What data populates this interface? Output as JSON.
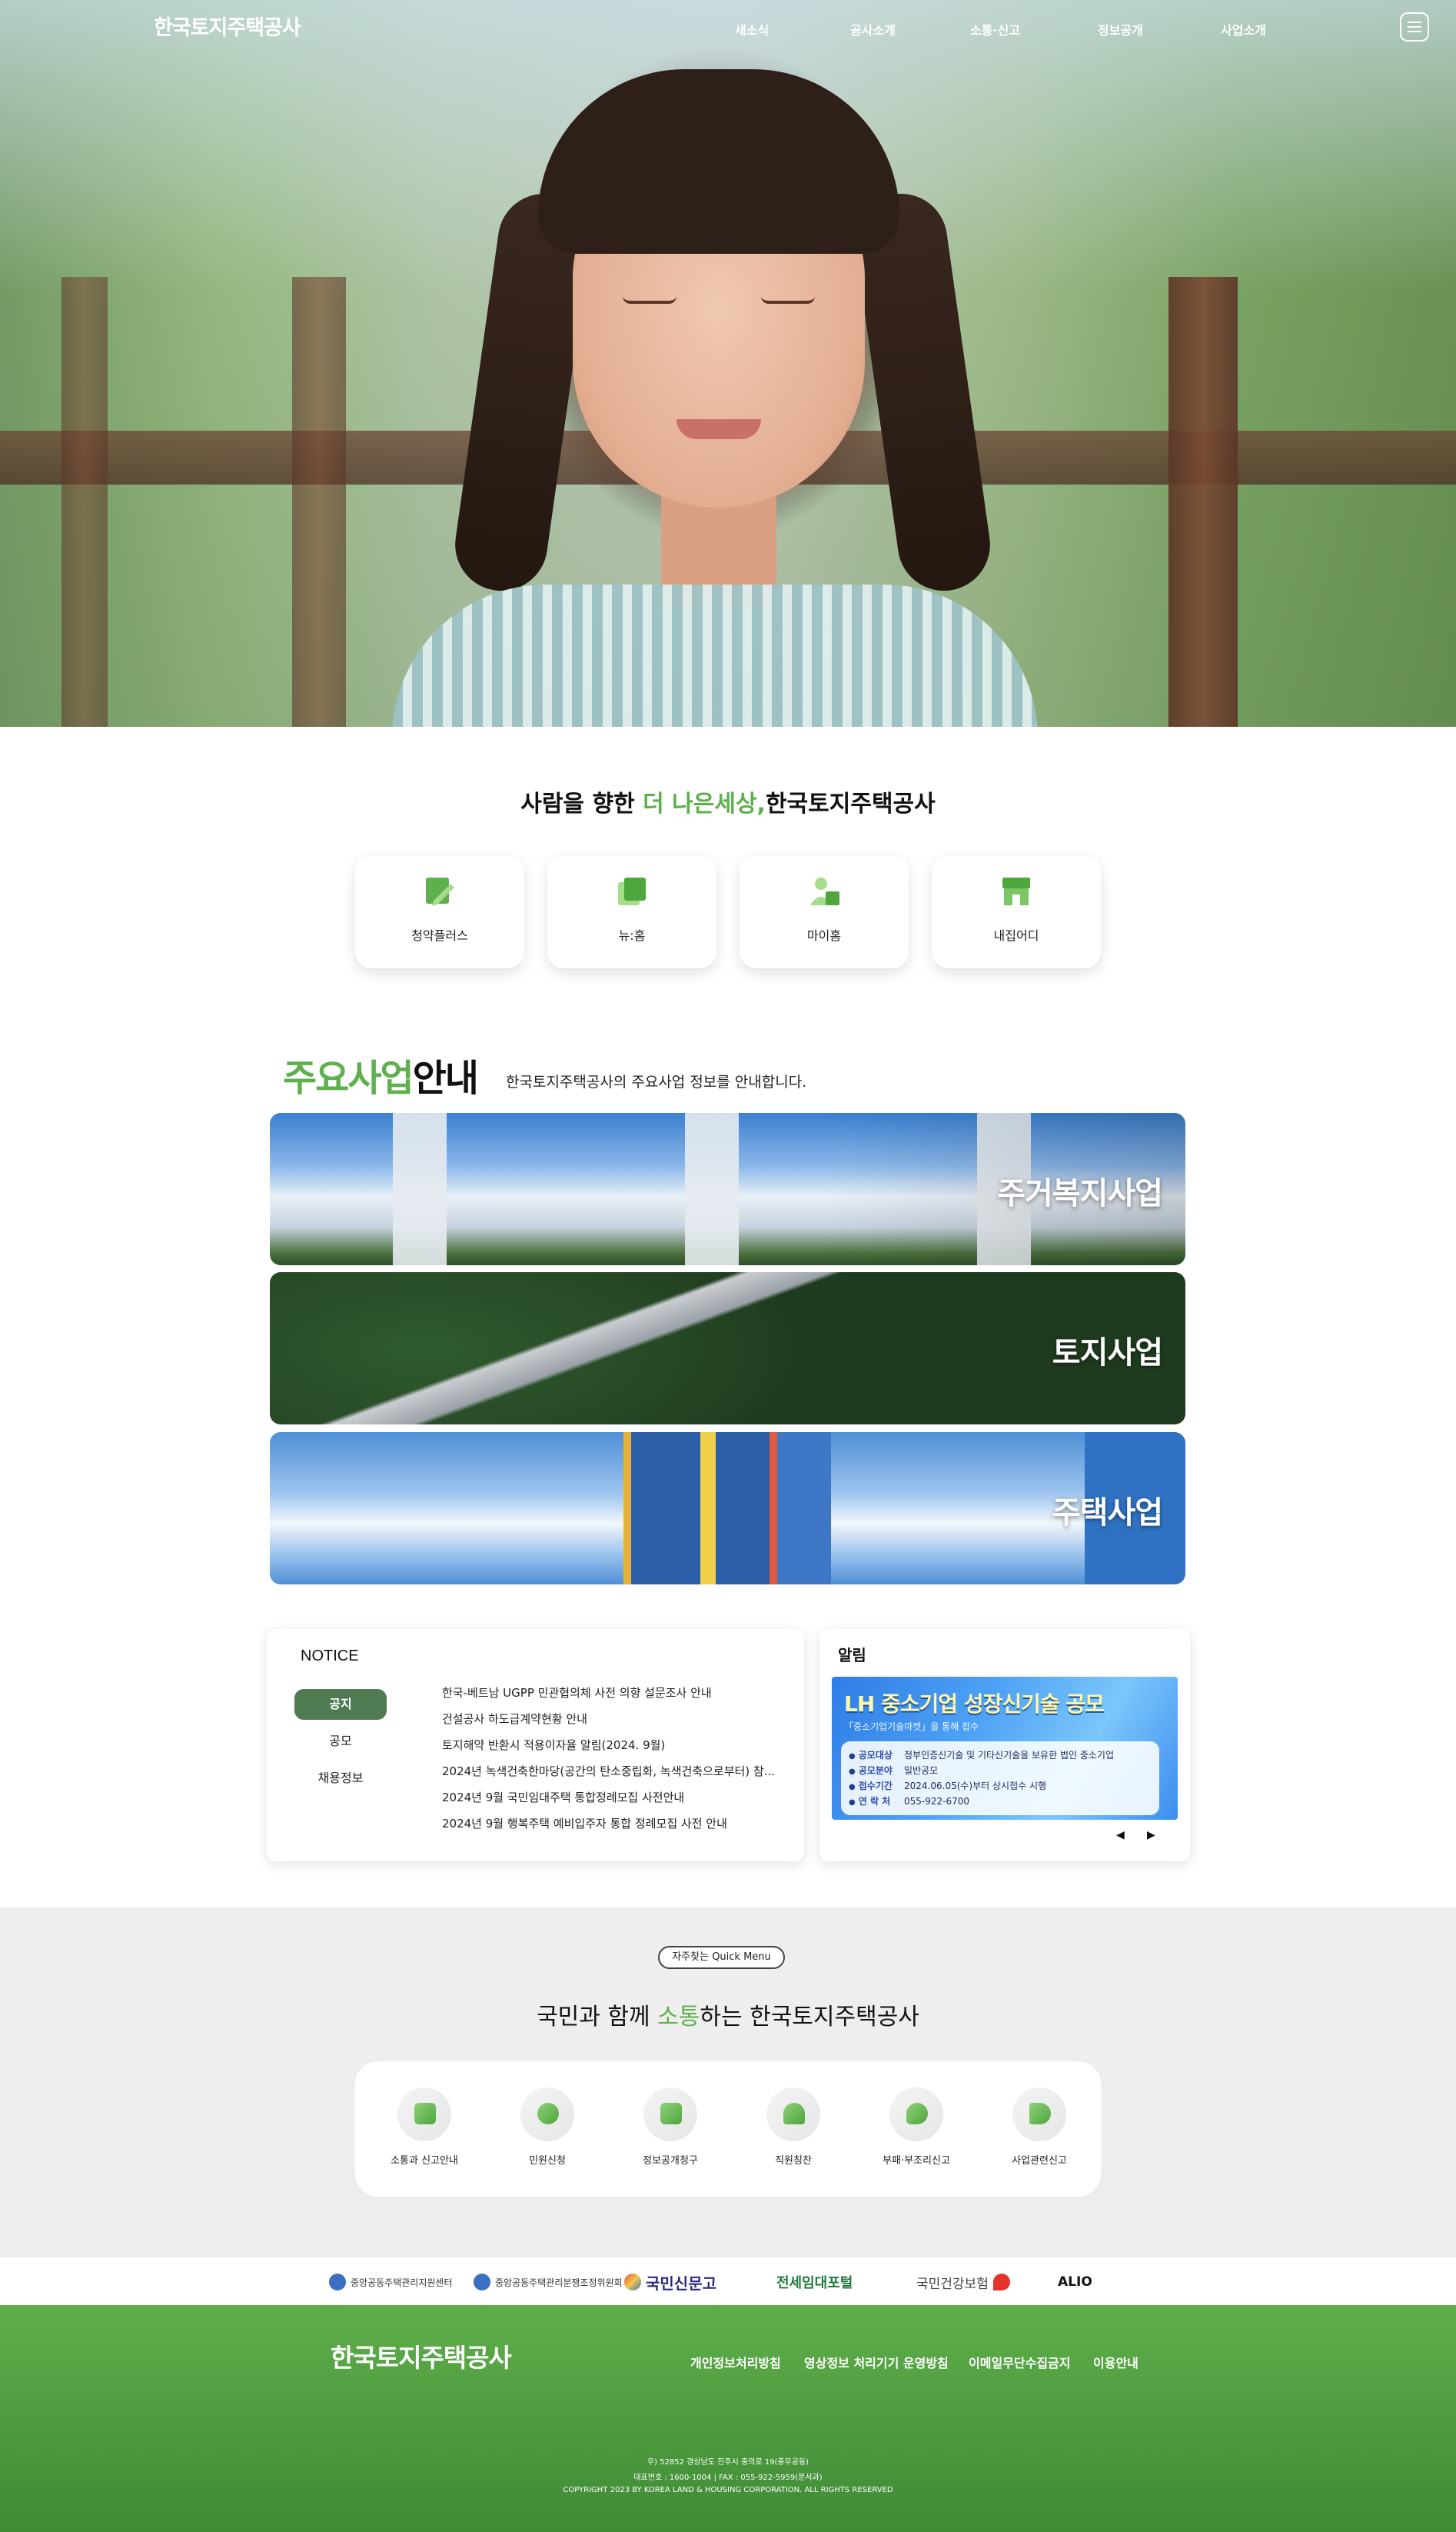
{
  "header": {
    "logo": "한국토지주택공사",
    "nav": [
      "새소식",
      "공사소개",
      "소통·신고",
      "정보공개",
      "사업소개"
    ],
    "menu_icon": "hamburger-menu-icon"
  },
  "hero": {
    "image": "child-smiling-in-park"
  },
  "slogan": {
    "prefix": "사람을 향한 ",
    "highlight": "더 나은세상,",
    "suffix": "한국토지주택공사"
  },
  "services": [
    {
      "label": "청약플러스",
      "icon": "pen-document-icon"
    },
    {
      "label": "뉴:홈",
      "icon": "stacked-pages-icon"
    },
    {
      "label": "마이홈",
      "icon": "person-house-icon"
    },
    {
      "label": "내집어디",
      "icon": "house-icon"
    }
  ],
  "main_business": {
    "title_highlight": "주요사업",
    "title_rest": "안내",
    "subtitle": "한국토지주택공사의 주요사업 정보를 안내합니다.",
    "cards": [
      "주거복지사업",
      "토지사업",
      "주택사업"
    ]
  },
  "notice": {
    "title": "NOTICE",
    "tabs": [
      "공지",
      "공모",
      "채용정보"
    ],
    "active_tab": "공지",
    "items": [
      "한국-베트남 UGPP 민관협의체 사전 의향 설문조사 안내",
      "건설공사 하도급계약현황 안내",
      "토지해약 반환시 적용이자율 알림(2024. 9월)",
      "2024년 녹색건축한마당(공간의 탄소중립화, 녹색건축으로부터) 참...",
      "2024년 9월 국민임대주택 통합정례모집 사전안내",
      "2024년 9월 행복주택 예비입주자 통합 정례모집 사전 안내"
    ]
  },
  "alarm": {
    "title": "알림",
    "banner": {
      "headline": "LH 중소기업 성장신기술 공모",
      "sub": "「중소기업기술마켓」을 통해 접수",
      "rows": [
        {
          "k": "공모대상",
          "v": "정부인증신기술 및 기타신기술을 보유한 법인 중소기업"
        },
        {
          "k": "공모분야",
          "v": "일반공모"
        },
        {
          "k": "접수기간",
          "v": "2024.06.05(수)부터 상시접수 시행"
        },
        {
          "k": "연 락 처",
          "v": "055-922-6700"
        }
      ]
    },
    "prev": "◀",
    "next": "▶"
  },
  "quick": {
    "pill": "자주찾는 Quick Menu",
    "title_prefix": "국민과 함께 ",
    "title_highlight": "소통",
    "title_suffix": "하는 한국토지주택공사",
    "items": [
      {
        "label": "소통과 신고안내",
        "icon": "document-stack-icon"
      },
      {
        "label": "민원신청",
        "icon": "headset-icon"
      },
      {
        "label": "정보공개청구",
        "icon": "folder-icon"
      },
      {
        "label": "직원칭찬",
        "icon": "people-icon"
      },
      {
        "label": "부패·부조리신고",
        "icon": "speech-bubble-icon"
      },
      {
        "label": "사업관련신고",
        "icon": "megaphone-icon"
      }
    ]
  },
  "partners": [
    "중앙공동주택관리지원센터",
    "중앙공동주택관리분쟁조정위원회",
    "국민신문고",
    "전세임대포털",
    "국민건강보험",
    "ALIO"
  ],
  "footer": {
    "logo": "한국토지주택공사",
    "links": [
      "개인정보처리방침",
      "영상정보 처리기기 운영방침",
      "이메일무단수집금지",
      "이용안내"
    ],
    "address": "우) 52852 경상남도 진주시 충의로 19(충무공동)",
    "contact": "대표번호 : 1600-1004 | FAX : 055-922-5959(문서과)",
    "copyright": "COPYRIGHT 2023 BY KOREA LAND & HOUSING CORPORATION. ALL RIGHTS RESERVED"
  },
  "colors": {
    "accent_green": "#5db04c",
    "tab_active": "#4f7a52",
    "footer_green": "#4f9c3f"
  }
}
